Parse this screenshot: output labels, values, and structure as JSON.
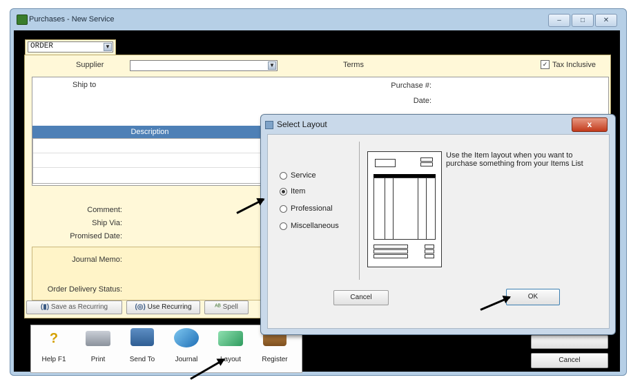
{
  "window": {
    "title": "Purchases - New Service",
    "controls": [
      "–",
      "□",
      "✕"
    ]
  },
  "form": {
    "type_value": "ORDER",
    "supplier_label": "Supplier",
    "terms_label": "Terms",
    "tax_inclusive_label": "Tax Inclusive",
    "tax_inclusive_checked": true,
    "ship_to_label": "Ship to",
    "purchase_no_label": "Purchase #:",
    "date_label": "Date:",
    "description_header": "Description",
    "comment_label": "Comment:",
    "ship_via_label": "Ship Via:",
    "promised_date_label": "Promised Date:",
    "journal_memo_label": "Journal Memo:",
    "order_delivery_label": "Order Delivery Status:"
  },
  "actions": {
    "save_recurring": "Save as Recurring",
    "use_recurring": "Use Recurring",
    "spell": "Spell"
  },
  "toolbar": {
    "items": [
      {
        "label": "Help F1",
        "icon": "help-icon"
      },
      {
        "label": "Print",
        "icon": "printer-icon"
      },
      {
        "label": "Send To",
        "icon": "send-to-icon"
      },
      {
        "label": "Journal",
        "icon": "journal-icon"
      },
      {
        "label": "Layout",
        "icon": "layout-icon"
      },
      {
        "label": "Register",
        "icon": "register-icon"
      }
    ],
    "cancel_label": "Cancel"
  },
  "dialog": {
    "title": "Select Layout",
    "close_glyph": "x",
    "options": [
      {
        "label": "Service",
        "selected": false
      },
      {
        "label": "Item",
        "selected": true
      },
      {
        "label": "Professional",
        "selected": false
      },
      {
        "label": "Miscellaneous",
        "selected": false
      }
    ],
    "description": "Use the Item layout when you want to purchase something from your Items List",
    "cancel_label": "Cancel",
    "ok_label": "OK"
  }
}
